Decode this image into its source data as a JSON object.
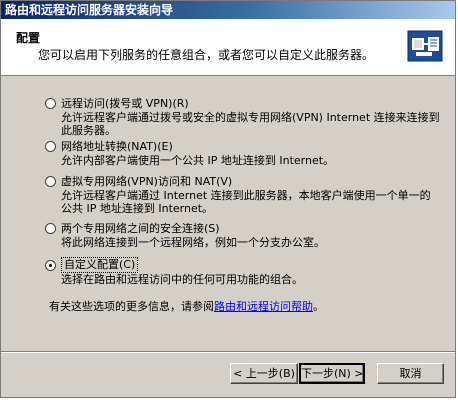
{
  "window": {
    "title": "路由和远程访问服务器安装向导"
  },
  "header": {
    "title": "配置",
    "subtitle": "您可以启用下列服务的任意组合，或者您可以自定义此服务器。",
    "icon": "server-wizard-icon"
  },
  "options": [
    {
      "label": "远程访问(拨号或 VPN)(R)",
      "description": "允许远程客户端通过拨号或安全的虚拟专用网络(VPN) Internet 连接来连接到此服务器。",
      "selected": false
    },
    {
      "label": "网络地址转换(NAT)(E)",
      "description": "允许内部客户端使用一个公共 IP 地址连接到 Internet。",
      "selected": false
    },
    {
      "label": "虚拟专用网络(VPN)访问和 NAT(V)",
      "description": "允许远程客户端通过 Internet 连接到此服务器，本地客户端使用一个单一的公共 IP 地址连接到 Internet。",
      "selected": false
    },
    {
      "label": "两个专用网络之间的安全连接(S)",
      "description": "将此网络连接到一个远程网络，例如一个分支办公室。",
      "selected": false
    },
    {
      "label": "自定义配置(C)",
      "description": "选择在路由和远程访问中的任何可用功能的组合。",
      "selected": true
    }
  ],
  "footer": {
    "note_prefix": "有关这些选项的更多信息，请参阅",
    "help_link": "路由和远程访问帮助",
    "note_suffix": "。"
  },
  "buttons": {
    "back": "< 上一步(B)",
    "next": "下一步(N) >",
    "cancel": "取消"
  },
  "colors": {
    "title_bar": "#0a246a",
    "dialog_bg": "#d4d0c8",
    "link": "#0000ff"
  }
}
